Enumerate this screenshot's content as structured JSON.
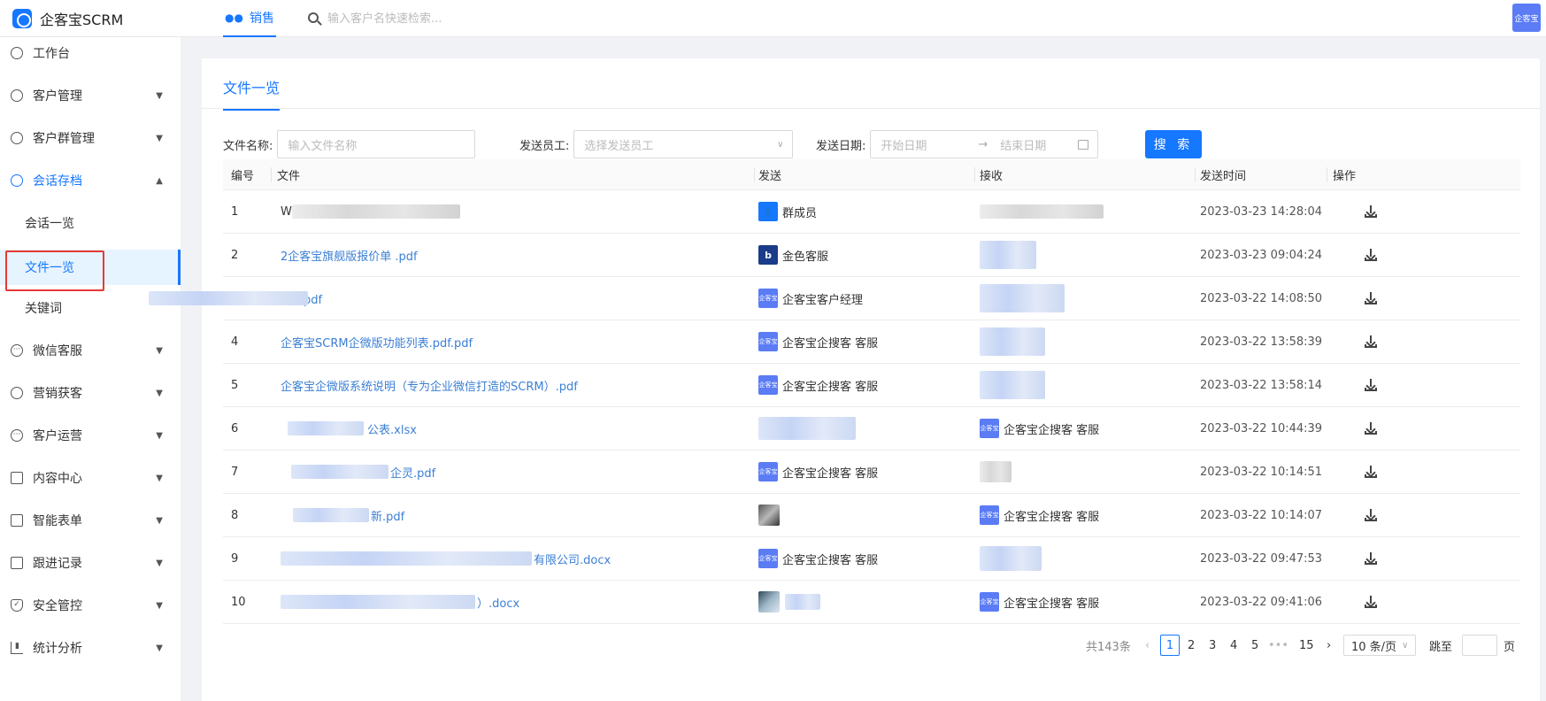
{
  "app": {
    "title": "企客宝SCRM",
    "avatar_label": "企客宝"
  },
  "topnav": {
    "tab_label": "销售",
    "search_placeholder": "输入客户名快速检索..."
  },
  "sidebar": {
    "items": [
      {
        "label": "工作台",
        "icon": "dashboard-icon"
      },
      {
        "label": "客户管理",
        "icon": "user-icon"
      },
      {
        "label": "客户群管理",
        "icon": "group-icon"
      },
      {
        "label": "会话存档",
        "icon": "chat-icon"
      },
      {
        "label": "会话一览"
      },
      {
        "label": "文件一览"
      },
      {
        "label": "关键词"
      },
      {
        "label": "微信客服",
        "icon": "service-icon"
      },
      {
        "label": "营销获客",
        "icon": "bulb-icon"
      },
      {
        "label": "客户运营",
        "icon": "ops-icon"
      },
      {
        "label": "内容中心",
        "icon": "content-icon"
      },
      {
        "label": "智能表单",
        "icon": "form-icon"
      },
      {
        "label": "跟进记录",
        "icon": "record-icon"
      },
      {
        "label": "安全管控",
        "icon": "shield-icon"
      },
      {
        "label": "统计分析",
        "icon": "chart-icon"
      }
    ]
  },
  "page": {
    "tab": "文件一览"
  },
  "filters": {
    "file_name_label": "文件名称:",
    "file_name_placeholder": "输入文件名称",
    "sender_label": "发送员工:",
    "sender_placeholder": "选择发送员工",
    "date_label": "发送日期:",
    "start_placeholder": "开始日期",
    "end_placeholder": "结束日期",
    "search_button": "搜 索"
  },
  "table": {
    "headers": [
      "编号",
      "文件",
      "发送",
      "接收",
      "发送时间",
      "操作"
    ],
    "rows": [
      {
        "no": "1",
        "file": "W",
        "sender": "群成员",
        "receiver": "",
        "time": "2023-03-23 14:28:04"
      },
      {
        "no": "2",
        "file": "2企客宝旗舰版报价单 .pdf",
        "sender": "金色客服",
        "receiver": "",
        "time": "2023-03-23 09:04:24"
      },
      {
        "no": "3",
        "file": "成都pdf",
        "sender": "企客宝客户经理",
        "receiver": "",
        "time": "2023-03-22 14:08:50"
      },
      {
        "no": "4",
        "file": "企客宝SCRM企微版功能列表.pdf.pdf",
        "sender": "企客宝企搜客 客服",
        "receiver": "",
        "time": "2023-03-22 13:58:39"
      },
      {
        "no": "5",
        "file": "企客宝企微版系统说明（专为企业微信打造的SCRM）.pdf",
        "sender": "企客宝企搜客 客服",
        "receiver": "",
        "time": "2023-03-22 13:58:14"
      },
      {
        "no": "6",
        "file": "公表.xlsx",
        "sender": "",
        "receiver": "企客宝企搜客 客服",
        "time": "2023-03-22 10:44:39"
      },
      {
        "no": "7",
        "file": "企灵.pdf",
        "sender": "企客宝企搜客 客服",
        "receiver": "",
        "time": "2023-03-22 10:14:51"
      },
      {
        "no": "8",
        "file": "新.pdf",
        "sender": "",
        "receiver": "企客宝企搜客 客服",
        "time": "2023-03-22 10:14:07"
      },
      {
        "no": "9",
        "file": "有限公司.docx",
        "sender": "企客宝企搜客 客服",
        "receiver": "",
        "time": "2023-03-22 09:47:53"
      },
      {
        "no": "10",
        "file": "）.docx",
        "sender": "",
        "receiver": "企客宝企搜客 客服",
        "time": "2023-03-22 09:41:06"
      }
    ]
  },
  "pagination": {
    "total": "共143条",
    "pages": [
      "1",
      "2",
      "3",
      "4",
      "5",
      "•••",
      "15"
    ],
    "current": "1",
    "page_size": "10 条/页",
    "jump_label": "跳至",
    "page_suffix": "页"
  },
  "colors": {
    "accent": "#1677ff",
    "highlight": "#e53935"
  }
}
